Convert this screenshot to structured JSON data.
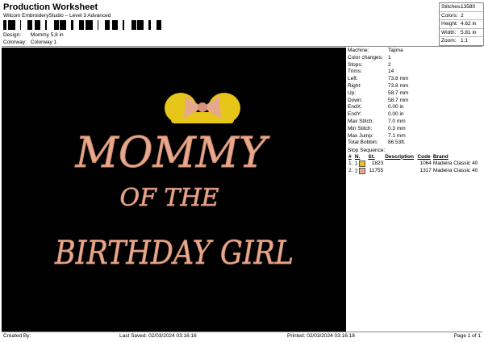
{
  "header": {
    "title": "Production Worksheet",
    "subtitle": "Wilcom EmbroideryStudio – Level 3 Advanced"
  },
  "design_info": {
    "design_label": "Design:",
    "design_value": "Mommy 5,8 in",
    "colorway_label": "Colorway:",
    "colorway_value": "Colorway 1"
  },
  "stats": [
    {
      "label": "Stitches:",
      "value": "13580"
    },
    {
      "label": "Colors:",
      "value": "2"
    },
    {
      "label": "Height:",
      "value": "4.62 in"
    },
    {
      "label": "Width:",
      "value": "5.81 in"
    },
    {
      "label": "Zoom:",
      "value": "1:1"
    }
  ],
  "machine_info": [
    {
      "label": "Machine:",
      "value": "Tajima"
    },
    {
      "label": "Color changes:",
      "value": "1"
    },
    {
      "label": "Stops:",
      "value": "2"
    },
    {
      "label": "Trims:",
      "value": "14"
    },
    {
      "label": "Left:",
      "value": "73.8 mm"
    },
    {
      "label": "Right:",
      "value": "73.8 mm"
    },
    {
      "label": "Up:",
      "value": "58.7 mm"
    },
    {
      "label": "Down:",
      "value": "58.7 mm"
    },
    {
      "label": "EndX:",
      "value": "0.00 in"
    },
    {
      "label": "EndY:",
      "value": "0.00 in"
    },
    {
      "label": "Max Stitch:",
      "value": "7.0 mm"
    },
    {
      "label": "Min Stitch:",
      "value": "0.3 mm"
    },
    {
      "label": "Max Jump:",
      "value": "7.1 mm"
    },
    {
      "label": "Total Bobbin:",
      "value": "86.53ft."
    }
  ],
  "stop_sequence": {
    "title": "Stop Sequence:",
    "headers": [
      "#",
      "N.",
      "St.",
      "Description",
      "Code",
      "Brand"
    ],
    "rows": [
      {
        "idx": "1.",
        "n": "1",
        "color": "#e6c619",
        "stitches": "1823",
        "description": "",
        "code": "1064",
        "brand": "Madeira Classic 40"
      },
      {
        "idx": "2.",
        "n": "2",
        "color": "#e8a88c",
        "stitches": "11755",
        "description": "",
        "code": "1317",
        "brand": "Madeira Classic 40"
      }
    ]
  },
  "artwork": {
    "line1": "MOMMY",
    "line2": "OF THE",
    "line3": "BIRTHDAY GIRL",
    "text_color": "#e8a88c",
    "ears_color": "#e6c619",
    "bow_color": "#e8a88c",
    "background": "#000000"
  },
  "footer": {
    "created_by": "Created By:",
    "last_saved": "Last Saved: 02/03/2024 03:16:16",
    "printed": "Printed: 02/03/2024 03:16:18",
    "page": "Page 1 of 1"
  }
}
